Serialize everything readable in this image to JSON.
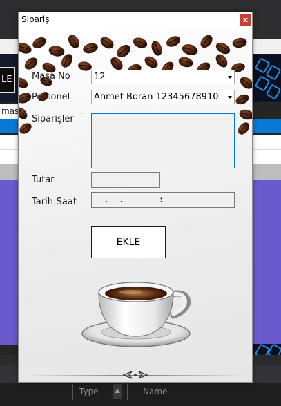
{
  "background": {
    "left_button_label": "LE",
    "row_label": "masa",
    "column_headers": [
      "Type",
      "Name"
    ]
  },
  "dialog": {
    "title": "Sipariş",
    "close_glyph": "x",
    "labels": {
      "table_no": "Masa No",
      "staff": "Personel",
      "orders": "Siparişler",
      "amount": "Tutar",
      "datetime": "Tarih-Saat"
    },
    "table_no_value": "12",
    "staff_value": "Ahmet Boran 12345678910",
    "amount_mask": "____",
    "datetime_mask": "__.__.____ __:__",
    "add_button_label": "EKLE"
  },
  "colors": {
    "close_button": "#c84031",
    "focus_border": "#0078d7",
    "selected_row": "#0a78d7",
    "purple_area": "#6a5acd",
    "hex_accent": "#1f8fe6"
  },
  "icons": [
    "chevron-down-icon",
    "close-icon",
    "coffee-cup-icon",
    "coffee-beans-icon",
    "ornament-icon"
  ]
}
